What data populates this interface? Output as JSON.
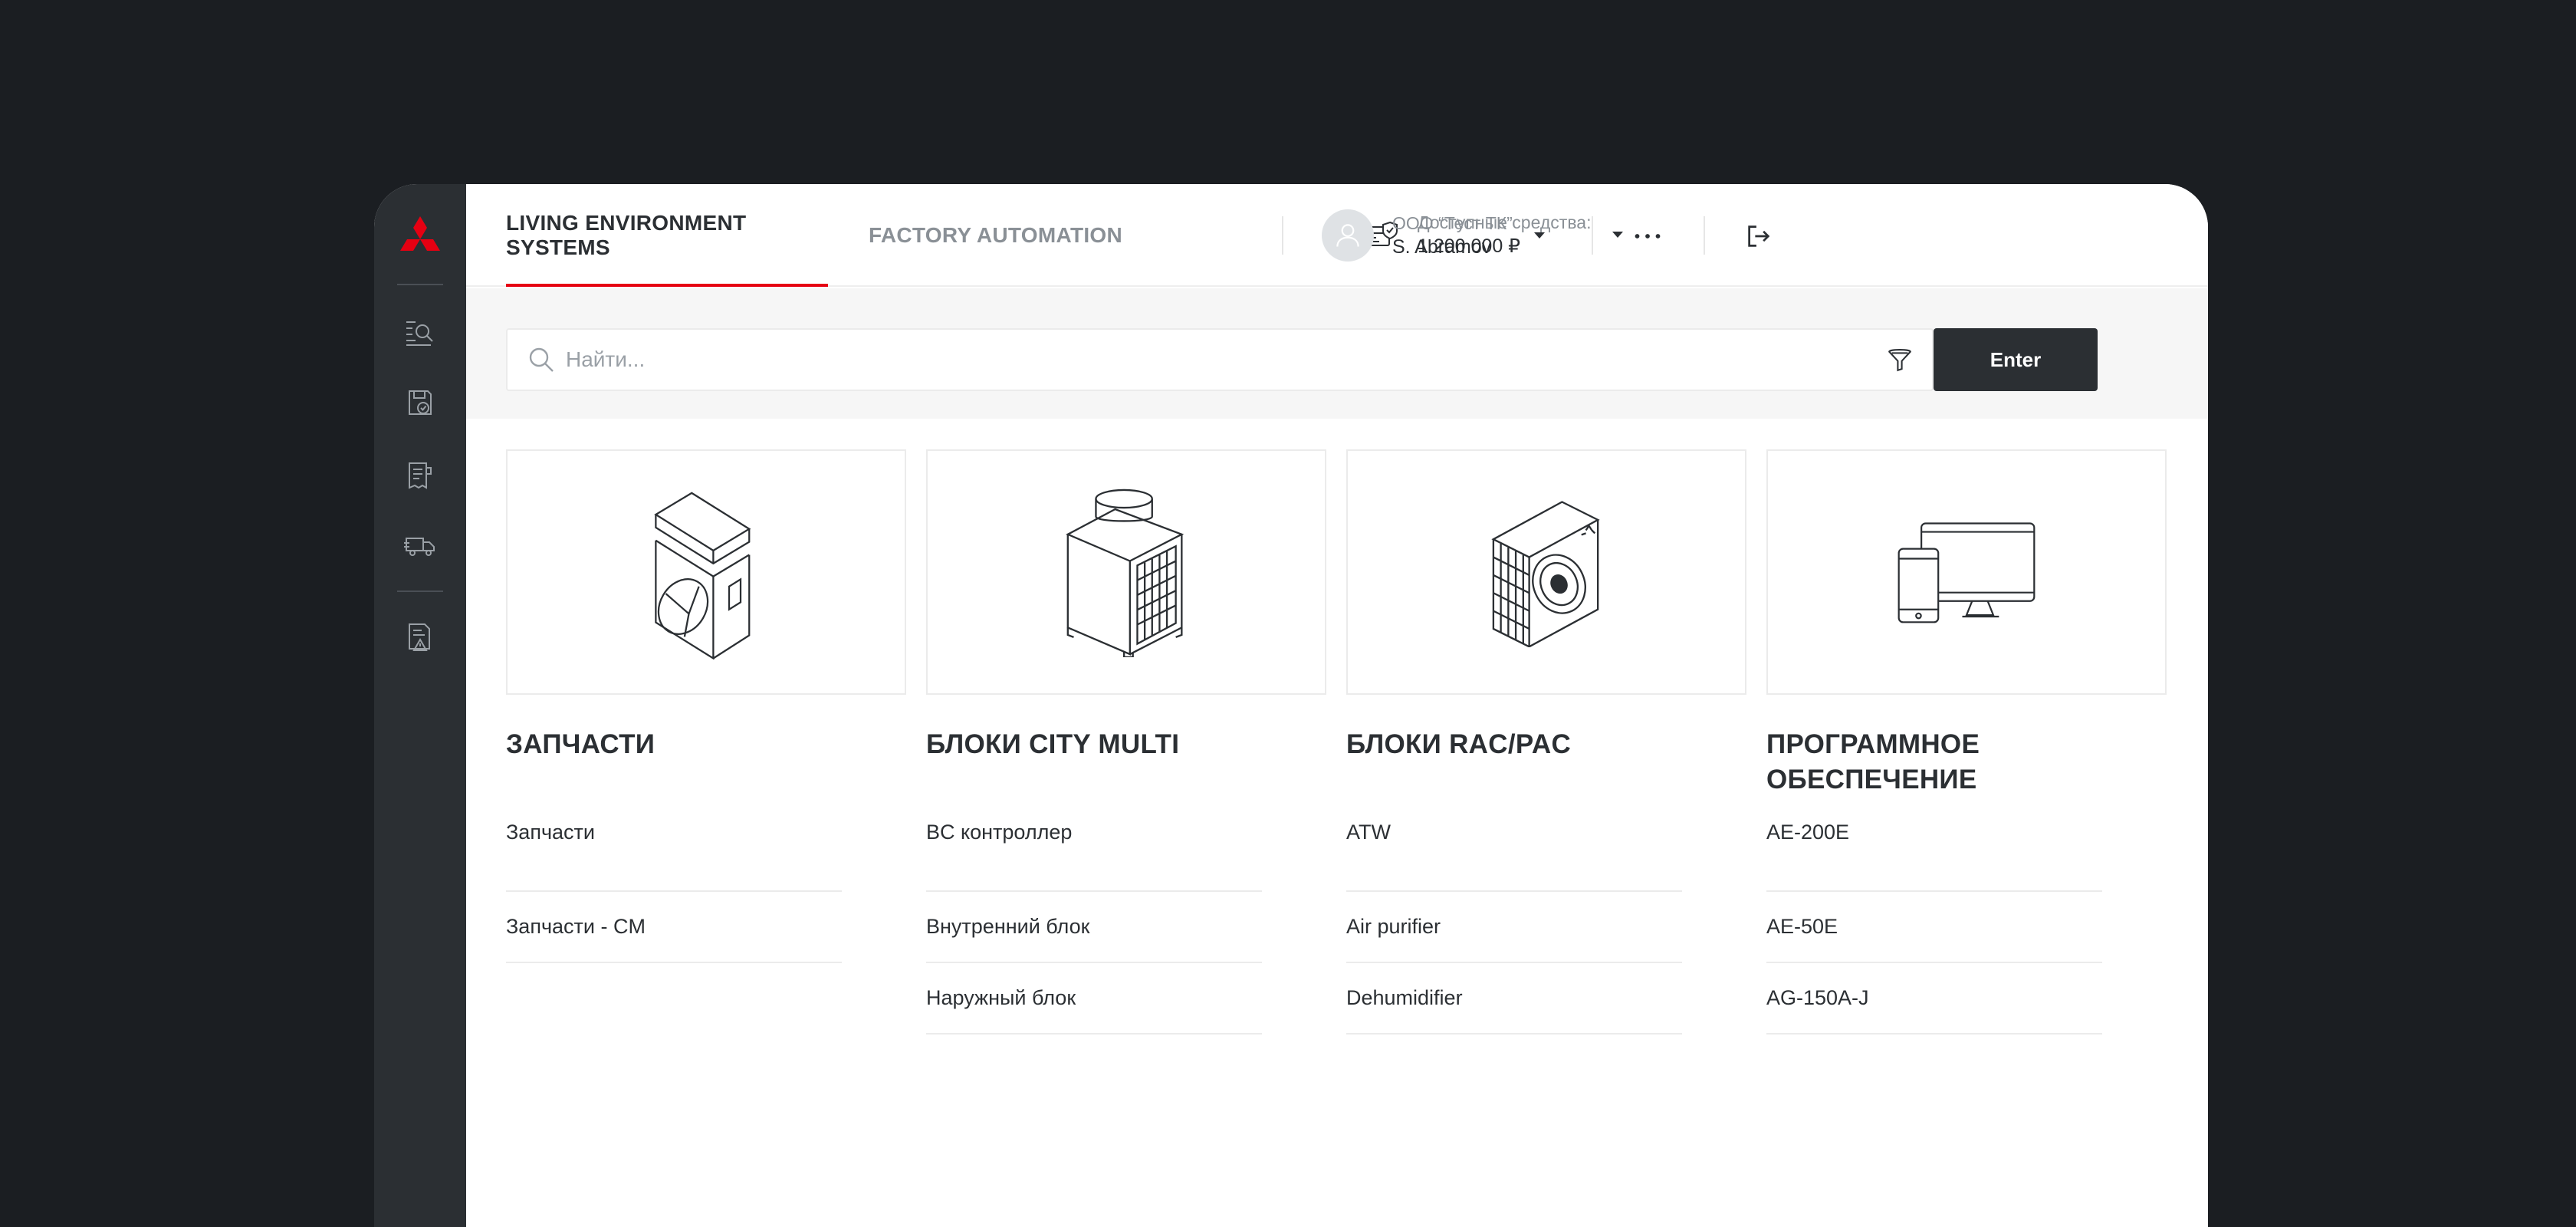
{
  "brand": {
    "accent_color": "#e60012",
    "logo_icon": "mitsubishi-three-diamonds-icon"
  },
  "sidebar": {
    "items": [
      {
        "icon": "catalog-search-icon"
      },
      {
        "icon": "saved-orders-icon"
      },
      {
        "icon": "invoice-icon"
      },
      {
        "icon": "delivery-truck-icon"
      },
      {
        "icon": "document-warning-icon"
      }
    ]
  },
  "header": {
    "tabs": [
      {
        "label": "LIVING ENVIRONMENT SYSTEMS",
        "active": true
      },
      {
        "label": "FACTORY AUTOMATION",
        "active": false
      }
    ],
    "funds": {
      "label": "Доступные средства:",
      "value": "1 200 000  ₽"
    },
    "user": {
      "company": "ООО “Тест ТК”",
      "name": "S. Abramov"
    }
  },
  "search": {
    "placeholder": "Найти...",
    "button_label": "Enter"
  },
  "categories": [
    {
      "title": "ЗАПЧАСТИ",
      "image": "spare-parts-unit",
      "links": [
        "Запчасти",
        "Запчасти - CM"
      ]
    },
    {
      "title": "БЛОКИ CITY MULTI",
      "image": "city-multi-unit",
      "links": [
        "BC контроллер",
        "Внутренний блок",
        "Наружный блок"
      ]
    },
    {
      "title": "БЛОКИ RAC/PAC",
      "image": "rac-pac-outdoor-unit",
      "links": [
        "ATW",
        "Air purifier",
        "Dehumidifier"
      ]
    },
    {
      "title": "ПРОГРАММНОЕ ОБЕСПЕЧЕНИЕ",
      "image": "software-devices",
      "links": [
        "AE-200E",
        "AE-50E",
        "AG-150A-J"
      ]
    }
  ]
}
